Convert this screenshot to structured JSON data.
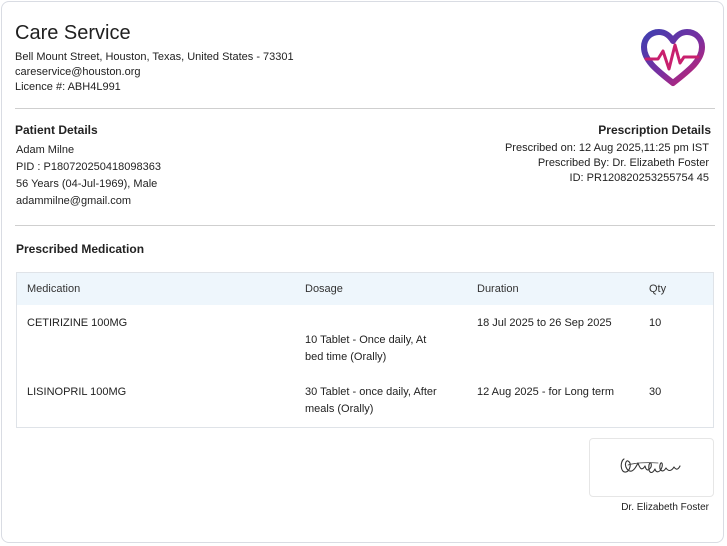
{
  "header": {
    "title": "Care Service",
    "address": "Bell Mount Street, Houston, Texas, United States - 73301",
    "email": "careservice@houston.org",
    "licence": "Licence #: ABH4L991",
    "logo_icon": "heart-pulse-logo"
  },
  "patient": {
    "heading": "Patient Details",
    "name": "Adam Milne",
    "pid": "PID : P180720250418098363",
    "age_line": "56 Years (04-Jul-1969), Male",
    "email": "adammilne@gmail.com"
  },
  "prescription": {
    "heading": "Prescription Details",
    "prescribed_on": "Prescribed on: 12 Aug 2025,11:25 pm IST",
    "prescribed_by": "Prescribed By: Dr. Elizabeth Foster",
    "id": "ID: PR120820253255754 45"
  },
  "medication": {
    "heading": "Prescribed Medication",
    "columns": [
      "Medication",
      "Dosage",
      "Duration",
      "Qty"
    ],
    "rows": [
      {
        "medication": "CETIRIZINE 100MG",
        "dosage_line1": "10 Tablet - Once daily, At",
        "dosage_line2": "bed time (Orally)",
        "duration": "18 Jul 2025 to 26 Sep 2025",
        "qty": "10"
      },
      {
        "medication": "LISINOPRIL 100MG",
        "dosage_line1": "30 Tablet - once daily, After",
        "dosage_line2": "meals (Orally)",
        "duration": "12 Aug 2025 - for Long term",
        "qty": "30"
      }
    ]
  },
  "signature": {
    "doctor": "Dr. Elizabeth Foster"
  },
  "colors": {
    "brand_purple": "#5b3fa8",
    "brand_magenta": "#c8206e",
    "table_header_bg": "#eef6fc"
  }
}
